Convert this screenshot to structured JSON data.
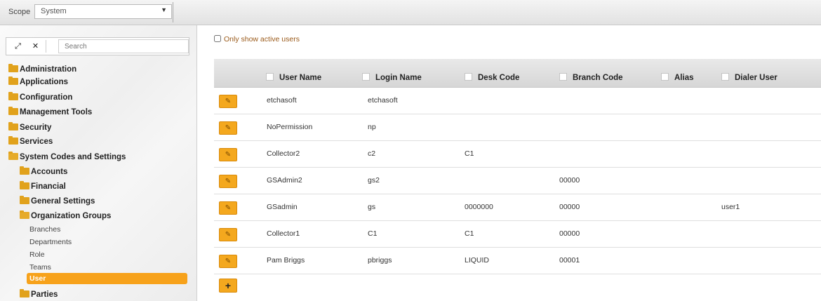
{
  "scope": {
    "label": "Scope",
    "value": "System"
  },
  "sidebar": {
    "search_placeholder": "Search",
    "tree": {
      "administration": "Administration",
      "applications": "Applications",
      "configuration": "Configuration",
      "management_tools": "Management Tools",
      "security": "Security",
      "services": "Services",
      "system_codes": "System Codes and Settings",
      "accounts": "Accounts",
      "financial": "Financial",
      "general_settings": "General Settings",
      "organization_groups": "Organization Groups",
      "branches": "Branches",
      "departments": "Departments",
      "role": "Role",
      "teams": "Teams",
      "user": "User",
      "parties": "Parties"
    }
  },
  "main": {
    "filter_label": "Only show active users",
    "columns": {
      "user_name": "User Name",
      "login_name": "Login Name",
      "desk_code": "Desk Code",
      "branch_code": "Branch Code",
      "alias": "Alias",
      "dialer_user": "Dialer User"
    },
    "rows": [
      {
        "user_name": "etchasoft",
        "login_name": "etchasoft",
        "desk_code": "",
        "branch_code": "",
        "alias": "",
        "dialer_user": ""
      },
      {
        "user_name": "NoPermission",
        "login_name": "np",
        "desk_code": "",
        "branch_code": "",
        "alias": "",
        "dialer_user": ""
      },
      {
        "user_name": "Collector2",
        "login_name": "c2",
        "desk_code": "C1",
        "branch_code": "",
        "alias": "",
        "dialer_user": ""
      },
      {
        "user_name": "GSAdmin2",
        "login_name": "gs2",
        "desk_code": "",
        "branch_code": "00000",
        "alias": "",
        "dialer_user": ""
      },
      {
        "user_name": "GSadmin",
        "login_name": "gs",
        "desk_code": "0000000",
        "branch_code": "00000",
        "alias": "",
        "dialer_user": "user1"
      },
      {
        "user_name": "Collector1",
        "login_name": "C1",
        "desk_code": "C1",
        "branch_code": "00000",
        "alias": "",
        "dialer_user": ""
      },
      {
        "user_name": "Pam Briggs",
        "login_name": "pbriggs",
        "desk_code": "LIQUID",
        "branch_code": "00001",
        "alias": "",
        "dialer_user": ""
      }
    ],
    "add_label": "+"
  }
}
